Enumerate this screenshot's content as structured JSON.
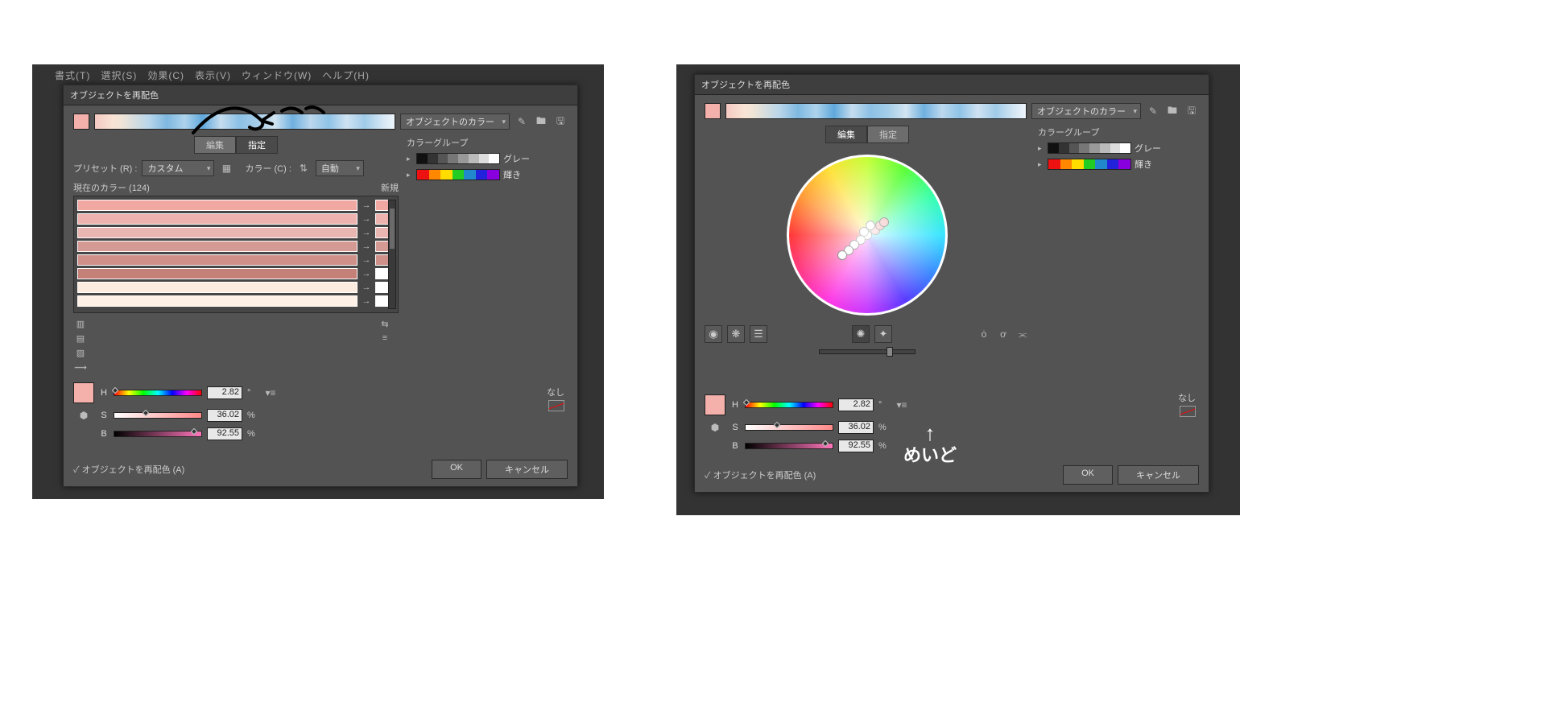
{
  "menubar": "書式(T)　選択(S)　効果(C)　表示(V)　ウィンドウ(W)　ヘルプ(H)",
  "dialog_title": "オブジェクトを再配色",
  "obj_colors_label": "オブジェクトのカラー",
  "tabs": {
    "edit": "編集",
    "assign": "指定"
  },
  "preset_label": "プリセット (R) :",
  "preset_value": "カスタム",
  "colorcount_label": "カラー (C) :",
  "colorcount_value": "自動",
  "currentcolors_label": "現在のカラー (124)",
  "new_label": "新規",
  "rows": [
    {
      "c": "#f1a8a2",
      "t": "#f1a8a2"
    },
    {
      "c": "#eeb3ae",
      "t": "#eeb3ae"
    },
    {
      "c": "#e9b6b1",
      "t": "#e9b6b1"
    },
    {
      "c": "#d59a93",
      "t": "#d59a93"
    },
    {
      "c": "#cf9089",
      "t": "#cf9089"
    },
    {
      "c": "#c58077",
      "t": "#ffffff"
    },
    {
      "c": "#fcece0",
      "t": "#ffffff"
    },
    {
      "c": "#fdf0e6",
      "t": "#ffffff"
    }
  ],
  "hsb": {
    "h": {
      "label": "H",
      "val": "2.82",
      "unit": "°"
    },
    "s": {
      "label": "S",
      "val": "36.02",
      "unit": "%"
    },
    "b": {
      "label": "B",
      "val": "92.55",
      "unit": "%"
    }
  },
  "main_swatch": "#f4b1ab",
  "colorgroup_title": "カラーグループ",
  "groups": {
    "gray": {
      "label": "グレー",
      "cols": [
        "#111",
        "#333",
        "#555",
        "#777",
        "#999",
        "#bbb",
        "#ddd",
        "#fff"
      ]
    },
    "bright": {
      "label": "輝き",
      "cols": [
        "#e11",
        "#f80",
        "#fd0",
        "#2c2",
        "#28c",
        "#22d",
        "#80d"
      ]
    }
  },
  "none_label": "なし",
  "recolor_checkbox": "オブジェクトを再配色 (A)",
  "ok": "OK",
  "cancel": "キャンセル",
  "annot_right": "めいど"
}
